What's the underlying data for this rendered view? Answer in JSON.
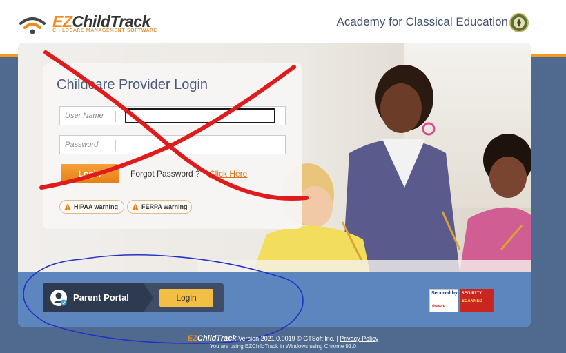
{
  "header": {
    "logo_ez": "EZ",
    "logo_rest": "ChildTrack",
    "logo_subtitle": "CHILDCARE MANAGEMENT SOFTWARE",
    "school_name": "Academy for Classical Education",
    "accent_color": "#f39a24"
  },
  "login": {
    "title": "Childcare Provider Login",
    "username_placeholder": "User Name",
    "password_placeholder": "Password",
    "login_button": "Login",
    "forgot_text": "Forgot Password ?",
    "click_here": "Click Here",
    "hipaa_warning": "HIPAA warning",
    "ferpa_warning": "FERPA warning"
  },
  "portal": {
    "label": "Parent Portal",
    "login_button": "Login"
  },
  "badges": {
    "thawte_line1": "Secured by",
    "thawte_line2": "thawte",
    "scan_line1": "SECURITY",
    "scan_line2": "SCANNED"
  },
  "footer": {
    "brand_ez": "EZ",
    "brand_rest": "ChildTrack",
    "version_text": "Version 2021.0.0019 © GTSoft Inc.",
    "separator": "|",
    "privacy_link": "Privacy Policy",
    "browser_text": "You are using EZChildTrack in Windows using Chrome 91.0"
  },
  "annotations": {
    "red_cross_color": "#e01b1b",
    "blue_ring_color": "#2230c8"
  },
  "icons": [
    "wifi-logo-icon",
    "school-seal-icon",
    "warning-icon",
    "user-avatar-icon"
  ]
}
